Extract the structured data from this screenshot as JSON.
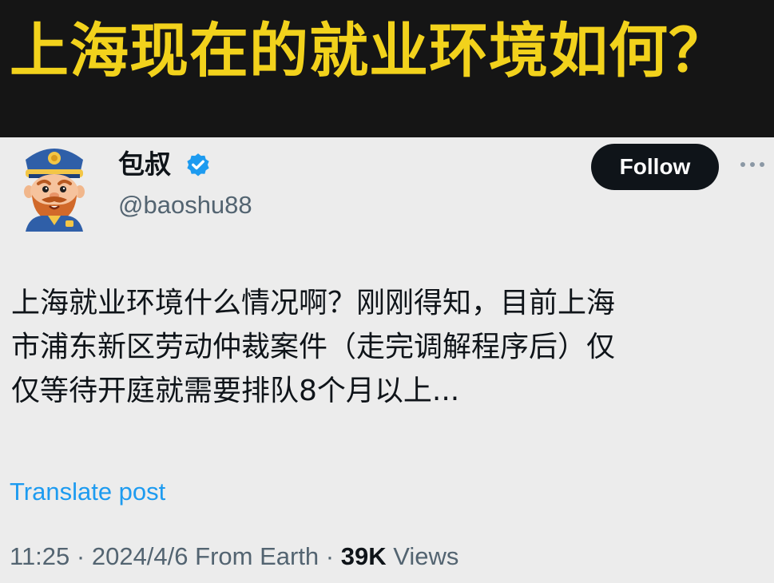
{
  "banner": {
    "title": "上海现在的就业环境如何？"
  },
  "post": {
    "author": {
      "display_name": "包叔",
      "handle": "@baoshu88",
      "verified": true
    },
    "follow_label": "Follow",
    "body_lines": [
      "上海就业环境什么情况啊？刚刚得知，目前上海",
      "市浦东新区劳动仲裁案件（走完调解程序后）仅",
      "仅等待开庭就需要排队8个月以上..."
    ],
    "translate_label": "Translate post",
    "meta": {
      "time": "11:25",
      "date": "2024/4/6",
      "source": "From Earth",
      "views_count": "39K",
      "views_label": "Views"
    }
  },
  "icons": {
    "verified": "verified-badge-icon",
    "more": "more-dots-icon",
    "avatar": "police-cartoon-avatar"
  },
  "colors": {
    "banner_bg": "#151515",
    "banner_text": "#f2d21c",
    "card_bg": "#ececec",
    "follow_bg": "#0f1419",
    "link": "#1d9bf0",
    "secondary_text": "#536471",
    "verified": "#1d9bf0"
  }
}
